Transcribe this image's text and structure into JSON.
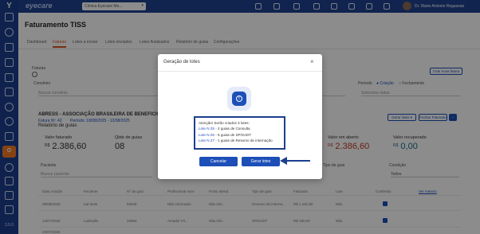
{
  "app": {
    "brand": "eyecare",
    "clinic": "Clínica Eyecare Me...",
    "user": "Dr. Mario Antonio Regassao",
    "version": "3.5.0"
  },
  "page": {
    "title": "Faturamento TISS"
  },
  "tabs": [
    "Dashboard",
    "Faturas",
    "Lotes a enviar",
    "Lotes enviados",
    "Lotes finalizados",
    "Relatório de guias",
    "Configurações"
  ],
  "filters": {
    "faturas_label": "Faturas",
    "convenio_label": "Convênio",
    "convenio_placeholder": "Buscar convênio",
    "periodo_label": "Período",
    "periodo_opt1": "Criação",
    "periodo_opt2": "Fechamento",
    "periodo_placeholder": "Selecione datas",
    "new_fatura": "Criar nova fatura"
  },
  "card": {
    "title": "ABRESS - ASSOCIAÇÃO BRASILEIRA DE BENEFICIOS E S",
    "fatura": "Fatura Nº: 42",
    "periodo": "Período: 18/08/2025 - 13/08/2025",
    "subtitle": "Relatório de guias",
    "btn_lote": "Gerar lotes ▾",
    "btn_fechar": "Fechar Faturado",
    "stats": [
      {
        "label": "Valor faturado",
        "currency": "R$",
        "value": "2.386,60"
      },
      {
        "label": "Qtde de guias",
        "currency": "",
        "value": "08"
      },
      {
        "label": "Valor em aberto",
        "currency": "R$",
        "value": "2.386,60"
      },
      {
        "label": "Valor recuperado",
        "currency": "R$",
        "value": "0,00"
      }
    ],
    "paciente_label": "Paciente",
    "paciente_placeholder": "Buscar paciente",
    "tipo_guia_label": "Tipo de guia",
    "condicao_label": "Condição",
    "condicao_value": "Todos"
  },
  "table": {
    "headers": [
      "Data criação",
      "Paciente",
      "Nº da guia",
      "Profissional exec",
      "Posto atend.",
      "Tipo de guia",
      "Faturado",
      "Lote",
      "Conferido",
      "Ver mesmo"
    ],
    "rows": [
      [
        "08/08/2025",
        "Iud teste",
        "83045",
        "Não informado",
        "Não info...",
        "Resumo de interna...",
        "R$ 1.181,80",
        "Não"
      ],
      [
        "14/07/2025",
        "Ludmylla",
        "34564",
        "Amador Fri...",
        "Não info...",
        "SP/SADT",
        "R$ 180,00",
        "Não"
      ],
      [
        "24/07/2025",
        "",
        "",
        "",
        "",
        "",
        "",
        ""
      ]
    ]
  },
  "modal": {
    "title": "Geração de lotes",
    "close": "×",
    "intro": "Atenção! Serão criados 3 lotes:",
    "lines": [
      {
        "lote": "Lote N 25",
        "rest": " - 2 guias de Consulta"
      },
      {
        "lote": "Lote N 26",
        "rest": " - 5 guias de SP/SADT"
      },
      {
        "lote": "Lote N 27",
        "rest": " - 1 guias de Resumo de internação"
      }
    ],
    "cancel": "Cancelar",
    "confirm": "Gerar lotes"
  },
  "colors": {
    "sidebar": "#1d3f8f",
    "accent": "#f47a20",
    "primary": "#1d4fb8",
    "danger": "#c0392b"
  }
}
